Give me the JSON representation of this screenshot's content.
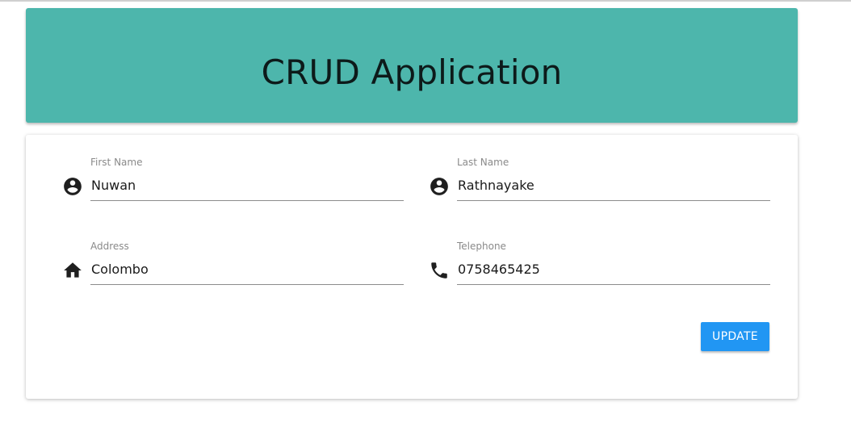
{
  "header": {
    "title": "CRUD Application",
    "background_color": "#4db6ac"
  },
  "form": {
    "fields": [
      {
        "label": "First Name",
        "value": "Nuwan",
        "icon": "account-circle-icon"
      },
      {
        "label": "Last Name",
        "value": "Rathnayake",
        "icon": "account-circle-icon"
      },
      {
        "label": "Address",
        "value": "Colombo",
        "icon": "home-icon"
      },
      {
        "label": "Telephone",
        "value": "0758465425",
        "icon": "phone-icon"
      }
    ],
    "update_label": "UPDATE",
    "button_color": "#2196f3"
  }
}
